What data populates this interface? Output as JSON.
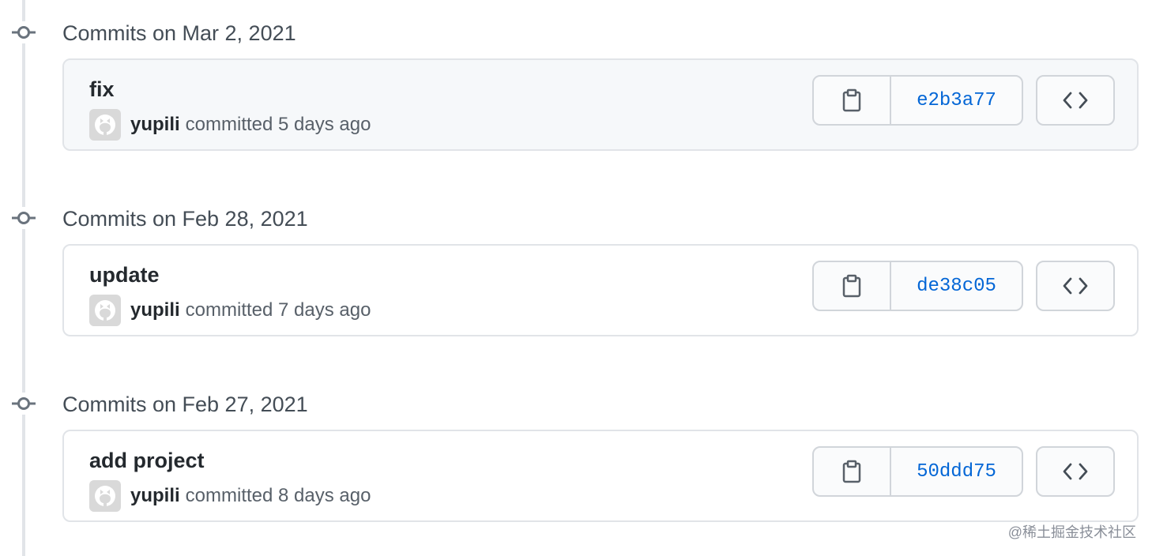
{
  "commit_groups": [
    {
      "date_label": "Commits on Mar 2, 2021",
      "commit": {
        "title": "fix",
        "author": "yupili",
        "committed_text": "committed 5 days ago",
        "sha": "e2b3a77",
        "highlighted": true
      }
    },
    {
      "date_label": "Commits on Feb 28, 2021",
      "commit": {
        "title": "update",
        "author": "yupili",
        "committed_text": "committed 7 days ago",
        "sha": "de38c05",
        "highlighted": false
      }
    },
    {
      "date_label": "Commits on Feb 27, 2021",
      "commit": {
        "title": "add project",
        "author": "yupili",
        "committed_text": "committed 8 days ago",
        "sha": "50ddd75",
        "highlighted": false
      }
    }
  ],
  "icons": {
    "commit_node": "git-commit-icon",
    "avatar": "github-octocat-icon",
    "copy": "clipboard-icon",
    "browse": "code-icon"
  },
  "colors": {
    "sha_link": "#0366d6",
    "highlight_bg": "#f6f8fa",
    "border": "#e1e4e8"
  },
  "watermark": "@稀土掘金技术社区"
}
